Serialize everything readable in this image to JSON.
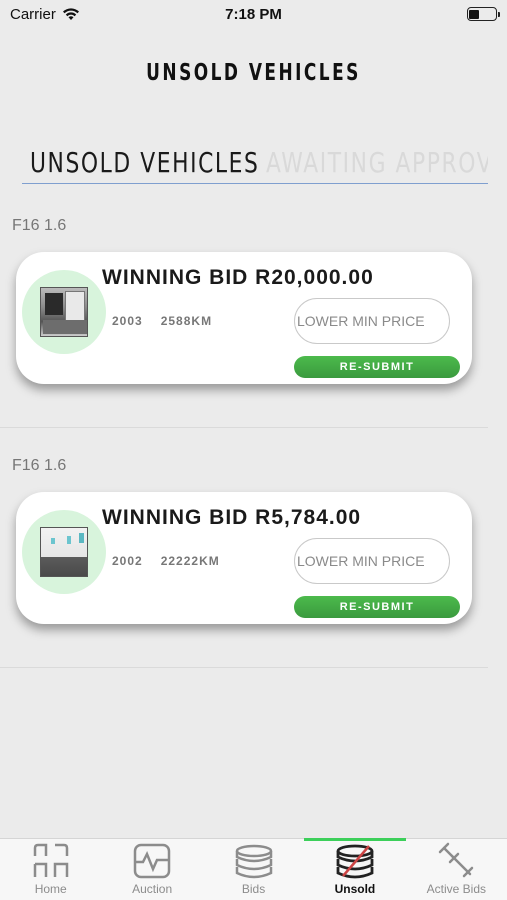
{
  "status_bar": {
    "carrier": "Carrier",
    "time": "7:18 PM",
    "battery_level": 0.4
  },
  "header": {
    "title": "UNSOLD VEHICLES"
  },
  "tabs": [
    {
      "label": "UNSOLD VEHICLES",
      "active": true
    },
    {
      "label": "AWAITING APPROVAL",
      "active": false
    }
  ],
  "vehicles": [
    {
      "model": "F16 1.6",
      "winning_bid": "WINNING BID R20,000.00",
      "year": "2003",
      "mileage": "2588KM",
      "min_price_placeholder": "LOWER MIN PRICE",
      "resubmit_label": "RE-SUBMIT"
    },
    {
      "model": "F16 1.6",
      "winning_bid": "WINNING BID R5,784.00",
      "year": "2002",
      "mileage": "22222KM",
      "min_price_placeholder": "LOWER MIN PRICE",
      "resubmit_label": "RE-SUBMIT"
    }
  ],
  "tabbar": {
    "items": [
      {
        "label": "Home",
        "icon": "home-grid-icon",
        "active": false
      },
      {
        "label": "Auction",
        "icon": "auction-pulse-icon",
        "active": false
      },
      {
        "label": "Bids",
        "icon": "coins-stack-icon",
        "active": false
      },
      {
        "label": "Unsold",
        "icon": "coins-crossed-icon",
        "active": true
      },
      {
        "label": "Active Bids",
        "icon": "gavel-icon",
        "active": false
      }
    ],
    "active_color": "#3ccf5a"
  },
  "colors": {
    "accent_green": "#3a9a3e",
    "tab_underline": "#7f9fcf",
    "thumb_bg": "#d8f4dc"
  }
}
